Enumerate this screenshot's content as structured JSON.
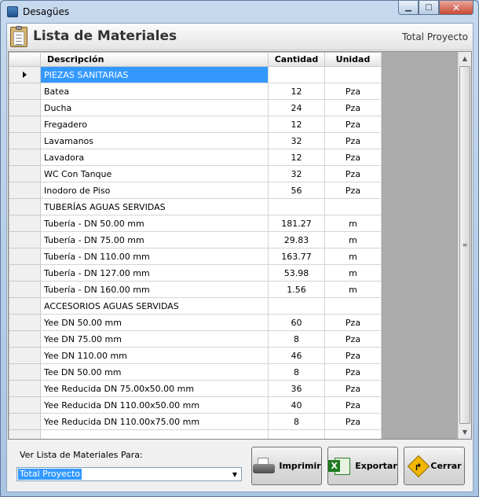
{
  "window": {
    "title": "Desagües"
  },
  "header": {
    "title": "Lista de Materiales",
    "scope": "Total Proyecto"
  },
  "table": {
    "columns": [
      "Descripción",
      "Cantidad",
      "Unidad"
    ],
    "rows": [
      {
        "desc": "PIEZAS SANITARIAS",
        "qty": "",
        "unit": "",
        "current": true
      },
      {
        "desc": "Batea",
        "qty": "12",
        "unit": "Pza"
      },
      {
        "desc": "Ducha",
        "qty": "24",
        "unit": "Pza"
      },
      {
        "desc": "Fregadero",
        "qty": "12",
        "unit": "Pza"
      },
      {
        "desc": "Lavamanos",
        "qty": "32",
        "unit": "Pza"
      },
      {
        "desc": "Lavadora",
        "qty": "12",
        "unit": "Pza"
      },
      {
        "desc": "WC Con Tanque",
        "qty": "32",
        "unit": "Pza"
      },
      {
        "desc": "Inodoro de Piso",
        "qty": "56",
        "unit": "Pza"
      },
      {
        "desc": "TUBERÍAS AGUAS SERVIDAS",
        "qty": "",
        "unit": ""
      },
      {
        "desc": "Tubería - DN 50.00 mm",
        "qty": "181.27",
        "unit": "m"
      },
      {
        "desc": "Tubería - DN 75.00 mm",
        "qty": "29.83",
        "unit": "m"
      },
      {
        "desc": "Tubería - DN 110.00 mm",
        "qty": "163.77",
        "unit": "m"
      },
      {
        "desc": "Tubería - DN 127.00 mm",
        "qty": "53.98",
        "unit": "m"
      },
      {
        "desc": "Tubería - DN 160.00 mm",
        "qty": "1.56",
        "unit": "m"
      },
      {
        "desc": "ACCESORIOS AGUAS SERVIDAS",
        "qty": "",
        "unit": ""
      },
      {
        "desc": "Yee DN 50.00 mm",
        "qty": "60",
        "unit": "Pza"
      },
      {
        "desc": "Yee DN 75.00 mm",
        "qty": "8",
        "unit": "Pza"
      },
      {
        "desc": "Yee DN 110.00 mm",
        "qty": "46",
        "unit": "Pza"
      },
      {
        "desc": "Tee DN 50.00 mm",
        "qty": "8",
        "unit": "Pza"
      },
      {
        "desc": "Yee Reducida DN 75.00x50.00 mm",
        "qty": "36",
        "unit": "Pza"
      },
      {
        "desc": "Yee Reducida DN 110.00x50.00 mm",
        "qty": "40",
        "unit": "Pza"
      },
      {
        "desc": "Yee Reducida DN 110.00x75.00 mm",
        "qty": "8",
        "unit": "Pza"
      },
      {
        "desc": "",
        "qty": "",
        "unit": ""
      }
    ]
  },
  "footer": {
    "view_label": "Ver Lista de Materiales Para:",
    "select_value": "Total Proyecto",
    "print_label": "Imprimir",
    "export_label": "Exportar",
    "close_label": "Cerrar"
  },
  "colors": {
    "selection": "#3399ff",
    "grid_background": "#ababab"
  },
  "icons": {
    "app": "app-icon",
    "clipboard": "clipboard-icon",
    "print": "printer-icon",
    "export": "excel-icon",
    "close": "exit-sign-icon"
  }
}
